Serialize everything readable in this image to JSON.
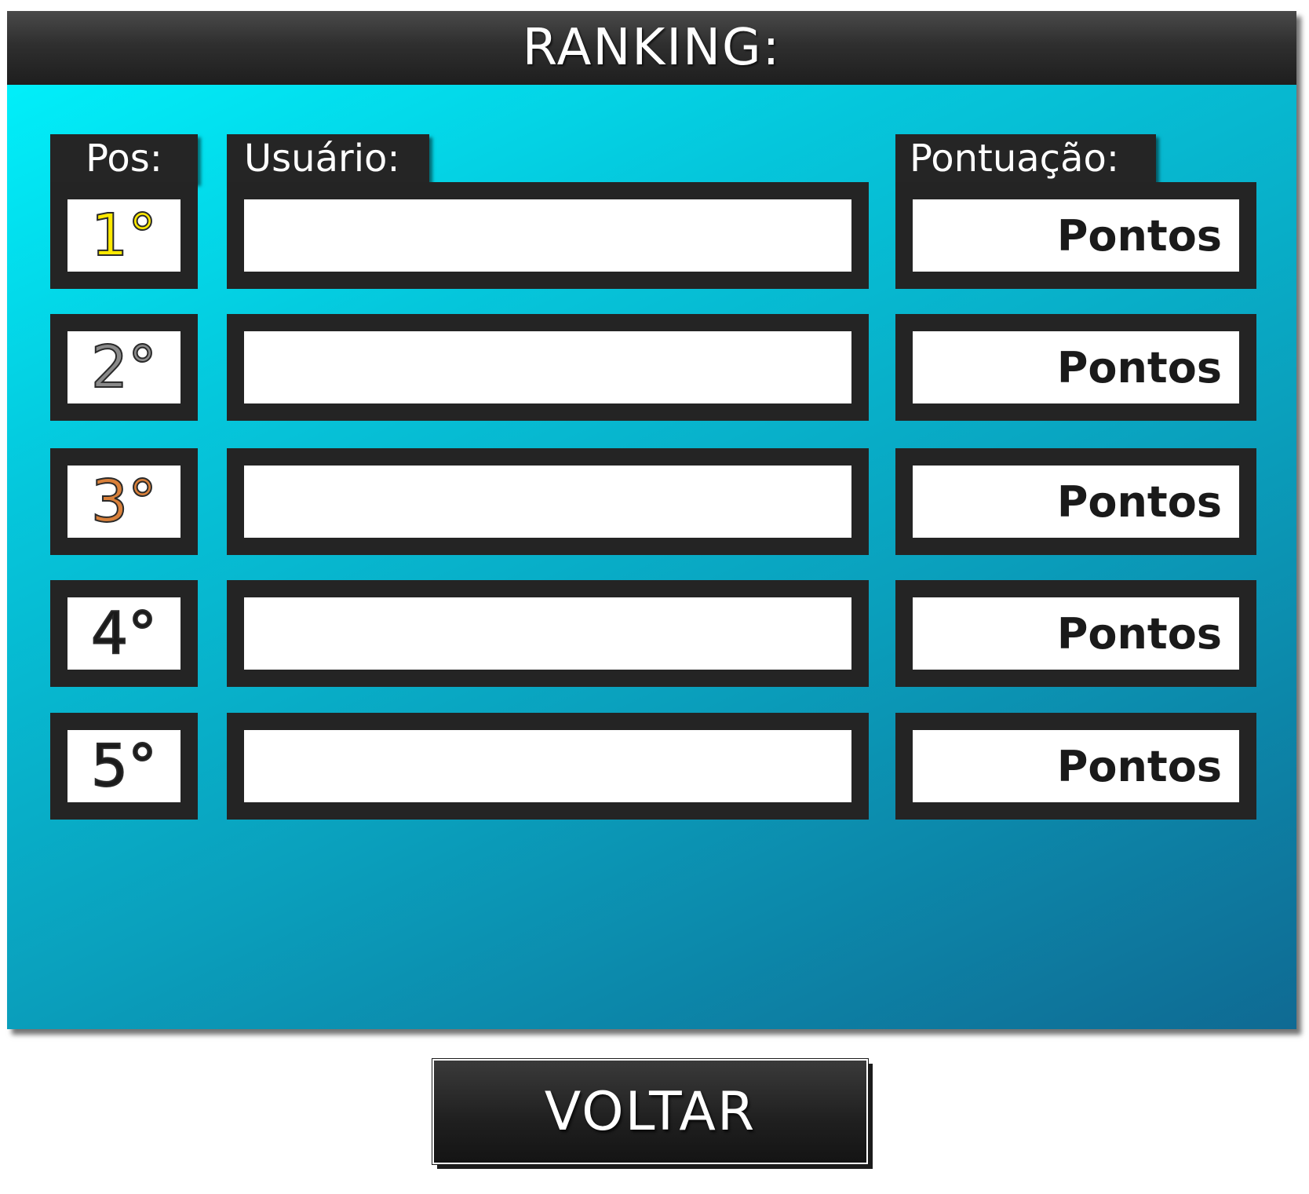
{
  "title": "RANKING:",
  "headers": {
    "position": "Pos:",
    "user": "Usuário:",
    "score": "Pontuação:"
  },
  "rows": [
    {
      "position": "1°",
      "position_color": "#ffea00",
      "user": "",
      "score": "Pontos"
    },
    {
      "position": "2°",
      "position_color": "#8a8a8a",
      "user": "",
      "score": "Pontos"
    },
    {
      "position": "3°",
      "position_color": "#d9803a",
      "user": "",
      "score": "Pontos"
    },
    {
      "position": "4°",
      "position_color": "#1a1a1a",
      "user": "",
      "score": "Pontos"
    },
    {
      "position": "5°",
      "position_color": "#1a1a1a",
      "user": "",
      "score": "Pontos"
    }
  ],
  "back_button": {
    "label": "VOLTAR"
  },
  "colors": {
    "panel_gradient_start": "#00f6ff",
    "panel_gradient_end": "#0f6a93",
    "dark": "#242424"
  }
}
